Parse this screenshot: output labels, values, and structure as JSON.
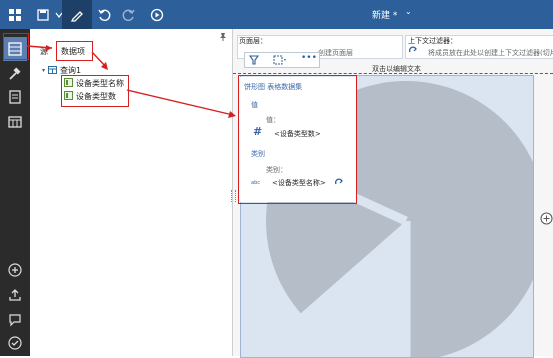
{
  "toolbar": {
    "document_title": "新建 *",
    "title_caret": "⌄"
  },
  "data_panel": {
    "source_tab": "源",
    "data_items_tab": "数据项",
    "query": "查询1",
    "items": [
      "设备类型名称",
      "设备类型数"
    ]
  },
  "filters": {
    "page_layer_label": "页面层：",
    "page_layer_hint": "创建页面层",
    "context_label": "上下文过滤器：",
    "context_hint": "将成员放在此处以创建上下文过滤器(切片",
    "edit_text_hint": "双击以编辑文本"
  },
  "popup": {
    "title": "饼形图 表格数据集",
    "value_section": "值",
    "value_label": "值：",
    "value_item": "<设备类型数>",
    "category_section": "类别",
    "category_label": "类别：",
    "category_item": "<设备类型名称>",
    "hash_icon_text": "#",
    "abc_icon_text": "abc"
  },
  "colors": {
    "top_bar": "#2d5f9a",
    "left_rail": "#2b2b2b",
    "highlight_red": "#d42020",
    "accent_blue": "#3b67a7"
  }
}
